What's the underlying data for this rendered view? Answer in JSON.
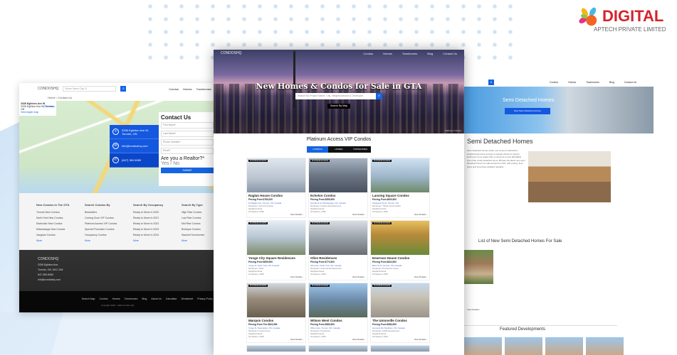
{
  "brand": {
    "name": "DIGITAL",
    "tagline": "APTECH PRIVATE LIMITED",
    "tm": "TM"
  },
  "colors": {
    "accent": "#1565e0",
    "brand_red": "#d4242b"
  },
  "left_page": {
    "logo": "CONDOSHQ",
    "search_placeholder": "Enter New City S",
    "nav": [
      "Condos",
      "Homes",
      "Townhomes"
    ],
    "breadcrumb": [
      "Home",
      "Contact Us"
    ],
    "map_card": {
      "title": "3336 Eglinton Ave W",
      "address": "3336 Eglinton Ave W, Toronto, ON",
      "link": "View larger map",
      "directions": "Directions"
    },
    "info": {
      "address": "3336 Eglinton Ave W, Toronto, ON",
      "email": "info@condoshq.com",
      "phone": "(647) 360 8080"
    },
    "form": {
      "title": "Contact Us",
      "fields": [
        "First Name*",
        "Last Name*",
        "Phone Number*",
        "Email*"
      ],
      "question": "Are you a Realtor?*",
      "option": "Yes / No",
      "submit": "SUBMIT"
    },
    "footer_cols": [
      {
        "title": "New Condos In The GTA",
        "items": [
          "Toronto New Condos",
          "North York New Condos",
          "Etobicoke New Condos",
          "Mississauga New Condos",
          "Vaughan Condos"
        ],
        "more": "More"
      },
      {
        "title": "Search Condos By",
        "items": [
          "Bestsellers",
          "Coming Soon VIP Condos",
          "Platinum Access VIP Condos",
          "Special Promotion Condos",
          "Occupancy Condos"
        ],
        "more": "More"
      },
      {
        "title": "Search By Occupancy",
        "items": [
          "Ready to Move In 2020",
          "Ready to Move In 2021",
          "Ready to Move In 2022",
          "Ready to Move In 2023",
          "Ready to Move In 2024"
        ],
        "more": "More"
      },
      {
        "title": "Search By Type",
        "items": [
          "High Rise Condos",
          "Low Rise Condos",
          "Mid Rise Condos",
          "Boutique Condos",
          "Stacked Townhomes"
        ],
        "more": "More"
      }
    ],
    "dark_footer": {
      "logo": "CONDOSHQ",
      "address1": "3336 Eglinton Ave,",
      "address2": "Toronto, ON, M1C 2A6",
      "phone": "647-360-8080",
      "email": "info@condoshq.com"
    },
    "bottom_links": [
      "Search Map",
      "Condos",
      "Homes",
      "Townhomes",
      "Blog",
      "About Us",
      "Calculator",
      "Worksheet",
      "Privacy Policy"
    ],
    "copyright": "Copyright 2020 - 2022 Condos HQ"
  },
  "center_page": {
    "logo": "CONDOSHQ",
    "nav": [
      "Condos",
      "Homes",
      "Townhomes",
      "Blog",
      "Contact Us"
    ],
    "hero_title": "New Homes & Condos for Sale in GTA",
    "search_placeholder": "Search By Project Name, City, Neighbourhood & Developer",
    "map_button": "Search By Map",
    "credit": "Platinum Condos",
    "section_title": "Platinum Access VIP Condos",
    "tabs": [
      "CONDOS",
      "HOMES",
      "TOWNHOMES"
    ],
    "view_label": "View Details ›",
    "cards": [
      {
        "tag": "PLATINUM ACCESS",
        "name": "Raglan House Condos",
        "price": "Pricing From $760,000",
        "address": "19 Raglan Ave, Toronto, ON, Canada",
        "developer": "Developer: Camrost Felcorp",
        "neighbourhood": "Neighbourhood:",
        "occupancy": "Occupancy: 2025",
        "bg": "linear-gradient(#dfe6ee,#b9c3cf 60%,#8896a6)"
      },
      {
        "tag": "PLATINUM ACCESS",
        "name": "Echelon Condos",
        "price": "Pricing From $595,990",
        "address": "Dundas St E, Mississauga, ON, Canada",
        "developer": "Developer: Amacon Developments",
        "neighbourhood": "Neighbourhood:",
        "occupancy": "Occupancy: 2026",
        "bg": "linear-gradient(#a8b4c2,#6c7684 50%,#4a5260)"
      },
      {
        "tag": "PLATINUM ACCESS",
        "name": "Lansing Square Condos",
        "price": "Pricing From $600,900",
        "address": "Sheppard Ave E, Toronto, ON",
        "developer": "Developer: Tribute Communities",
        "neighbourhood": "Neighbourhood:",
        "occupancy": "Occupancy: 2026",
        "bg": "linear-gradient(#cfe2f2,#9cb4c8 55%,#6f8a6a)"
      },
      {
        "tag": "PLATINUM ACCESS",
        "name": "Yonge City Square Residences",
        "price": "Pricing From $659,990",
        "address": "Yonge St, North York, ON, Canada",
        "developer": "Developer: Tridel",
        "neighbourhood": "Neighbourhood:",
        "occupancy": "Occupancy: 2025",
        "bg": "linear-gradient(#e6eef6,#b6c4d2 50%,#7c8a6a)"
      },
      {
        "tag": "PLATINUM ACCESS",
        "name": "Olive Residences",
        "price": "Pricing From $774,900",
        "address": "Olive Ave, North York, ON, Canada",
        "developer": "Developer: Camrost Developments",
        "neighbourhood": "Neighbourhood:",
        "occupancy": "Occupancy: 2025",
        "bg": "linear-gradient(#d8dde2,#9aa2aa 50%,#6a6e72)"
      },
      {
        "tag": "PLATINUM ACCESS",
        "name": "Emerson House Condos",
        "price": "Pricing From $824,900",
        "address": "Bloor St W, Toronto, ON, Canada",
        "developer": "Developer: Pemberton Group",
        "neighbourhood": "Neighbourhood:",
        "occupancy": "Occupancy: 2025",
        "bg": "linear-gradient(#e8c060,#b88a3a 40%,#6a8a3a)"
      },
      {
        "tag": "PLATINUM ACCESS",
        "name": "Marquis Condos",
        "price": "Pricing From The $514,990",
        "address": "Yonge St, Newmarket, ON, Canada",
        "developer": "Developer: Cortel Group",
        "neighbourhood": "Neighbourhood:",
        "occupancy": "Occupancy: 2025",
        "bg": "linear-gradient(#cfd8e0,#9a8c7c 45%,#6a6050)"
      },
      {
        "tag": "PLATINUM ACCESS",
        "name": "Wilson West Condos",
        "price": "Pricing From $580,900",
        "address": "Wilson Ave, Toronto, ON, Canada",
        "developer": "Developer: Pemberton",
        "neighbourhood": "Neighbourhood:",
        "occupancy": "Occupancy: 2025",
        "bg": "linear-gradient(#9ec6ea,#6c8aa8 50%,#5a6a5a)"
      },
      {
        "tag": "PLATINUM ACCESS",
        "name": "The Unionville Condos",
        "price": "Pricing From $583,990",
        "address": "Kennedy Rd, Markham, ON, Canada",
        "developer": "Developer: H&W Development",
        "neighbourhood": "Neighbourhood:",
        "occupancy": "Occupancy: 2025",
        "bg": "linear-gradient(#c4d8ec,#c8c2b6 40%,#9a948a)"
      }
    ]
  },
  "right_page": {
    "nav": [
      "Condos",
      "Homes",
      "Townhomes",
      "Blog",
      "Contact Us"
    ],
    "hero_title": "Semi Detached Homes",
    "hero_button": "New Semi Detached Homes",
    "heading": "Semi Detached Homes",
    "paragraph": "Semi detached homes share one common wall with a neighbouring home and are a popular choice for buyers looking for more space than a condo at a more affordable price than a fully detached home. Browse the latest new semi detached homes for sale across the GTA, with pricing, floor plans and incentives updated regularly.",
    "list_title": "List of New Semi Detached Homes For Sale",
    "view_label": "View Details ›",
    "featured_title": "Featured Developments"
  }
}
